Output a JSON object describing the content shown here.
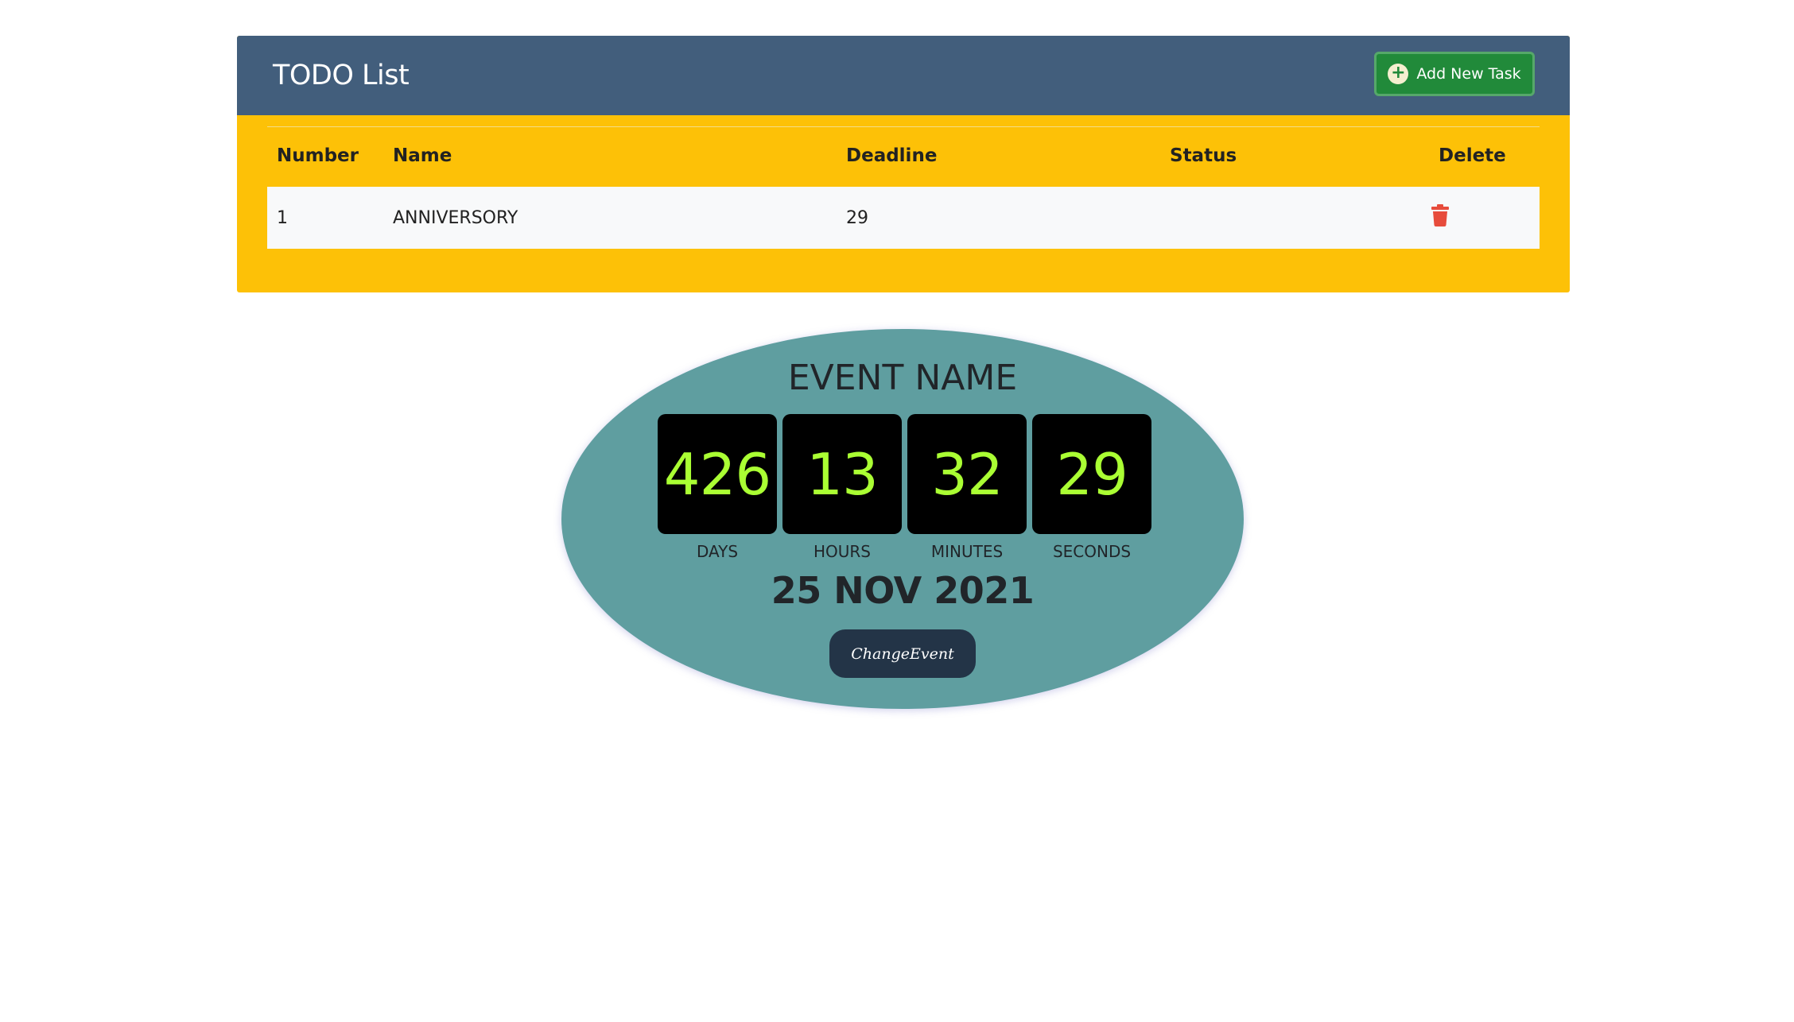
{
  "todo": {
    "title": "TODO List",
    "add_button_label": "Add New Task",
    "columns": {
      "number": "Number",
      "name": "Name",
      "deadline": "Deadline",
      "status": "Status",
      "delete": "Delete"
    },
    "rows": [
      {
        "number": "1",
        "name": "ANNIVERSORY",
        "deadline": "29",
        "status": ""
      }
    ]
  },
  "event": {
    "name": "EVENT NAME",
    "countdown": {
      "days": "426",
      "hours": "13",
      "minutes": "32",
      "seconds": "29"
    },
    "labels": {
      "days": "DAYS",
      "hours": "HOURS",
      "minutes": "MINUTES",
      "seconds": "SECONDS"
    },
    "date": "25 NOV 2021",
    "change_button_label": "ChangeEvent"
  },
  "colors": {
    "header_bg": "#425e7c",
    "card_bg": "#fdc107",
    "add_button": "#218a3a",
    "event_bg": "#5f9ea0",
    "countdown_digits": "#aaff33",
    "delete_icon": "#e74c3c"
  },
  "icons": {
    "add": "plus-circle-icon",
    "delete": "trash-icon"
  }
}
